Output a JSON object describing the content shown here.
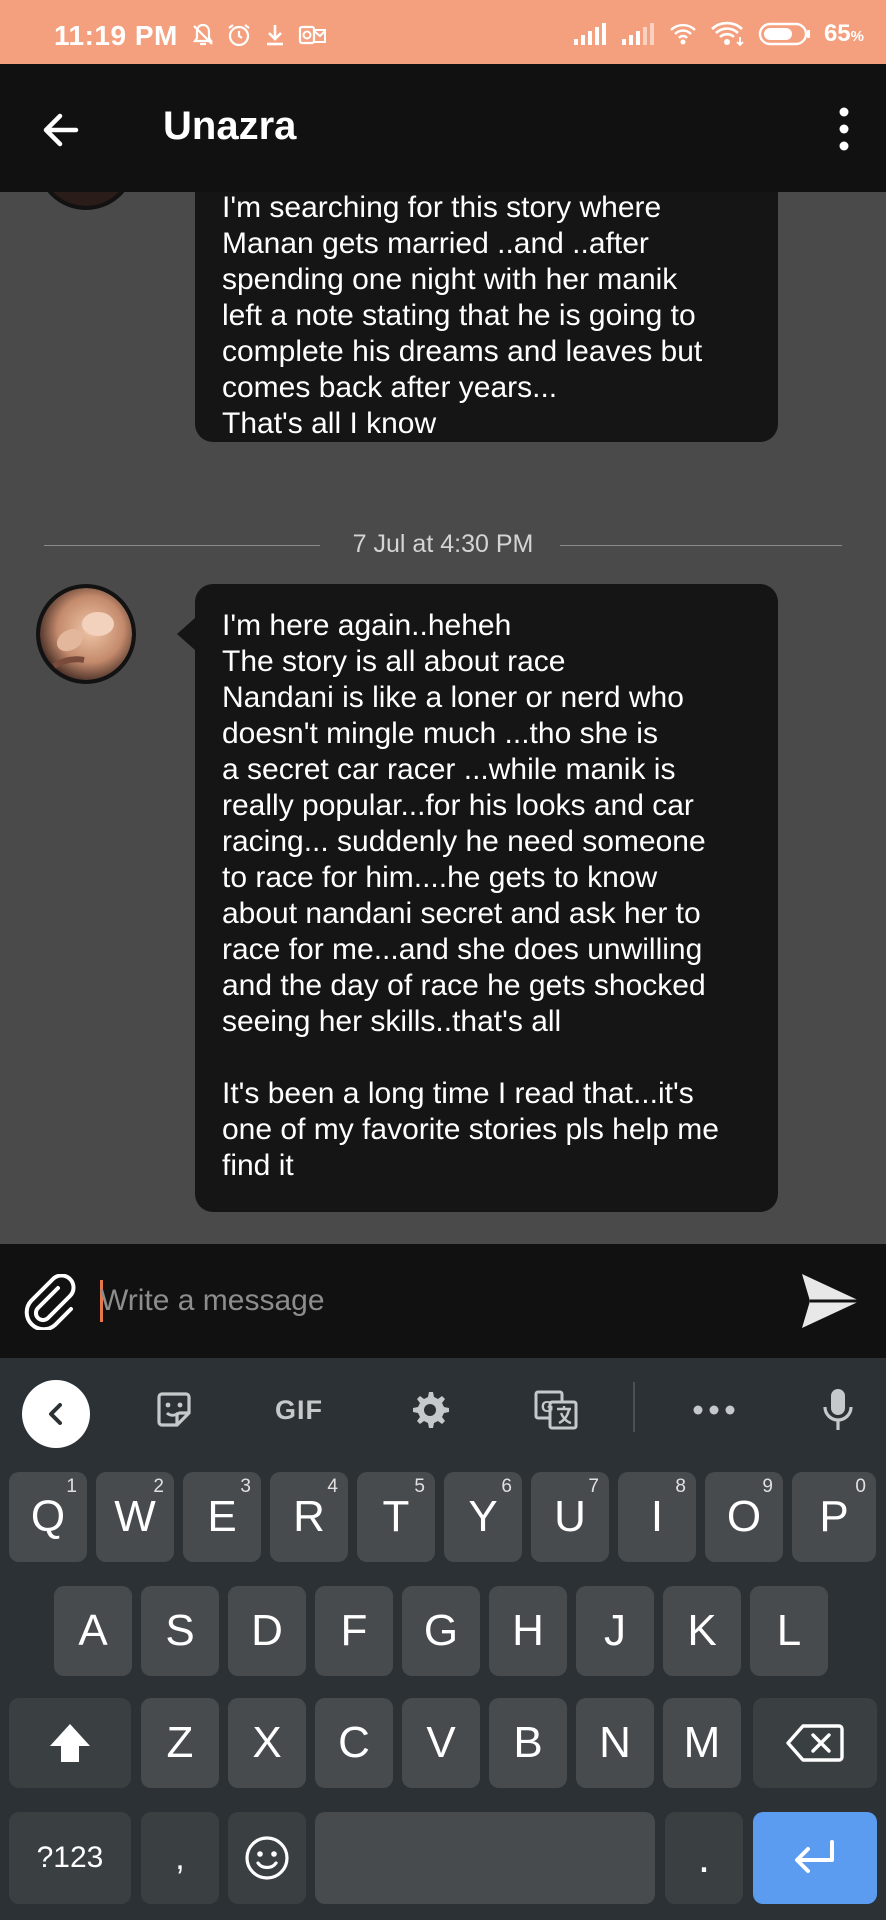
{
  "status_bar": {
    "time": "11:19 PM",
    "battery_percent": "65",
    "battery_unit": "%",
    "left_icons": [
      "mute-bell-icon",
      "alarm-icon",
      "download-icon",
      "outlook-icon"
    ],
    "right_icons": [
      "signal-icon",
      "signal-2-icon",
      "hotspot-icon",
      "wifi-icon",
      "battery-icon"
    ],
    "background": "#f4a07e"
  },
  "app_bar": {
    "title": "Unazra",
    "back_icon": "arrow-left-icon",
    "more_icon": "more-vertical-icon"
  },
  "messages": [
    {
      "text": " I'm searching for this story where\nManan gets married ..and ..after\nspending one night with her manik\nleft a note stating that he is going to\ncomplete his dreams and leaves but\ncomes back after years...\nThat's all I know"
    },
    {
      "text": "I'm here again..heheh\nThe story is all about race\nNandani is like a loner or nerd who\ndoesn't mingle much ...tho she is\na secret car racer ...while manik is\nreally popular...for his looks and car\nracing... suddenly he need someone\nto race for him....he gets to know\nabout nandani secret and ask her to\nrace for me...and she does unwilling\nand the day of race he gets shocked\nseeing her skills..that's all\n\nIt's been a long time I  read that...it's\none of my favorite stories pls help me\nfind it"
    }
  ],
  "date_separator": "7 Jul at 4:30 PM",
  "composer": {
    "placeholder": "Write a message",
    "value": "",
    "attach_icon": "paperclip-icon",
    "send_icon": "send-icon"
  },
  "keyboard": {
    "toolbar": {
      "back_icon": "chevron-left-icon",
      "sticker_icon": "sticker-icon",
      "gif_label": "GIF",
      "settings_icon": "gear-icon",
      "translate_icon": "translate-icon",
      "more_icon": "more-horizontal-icon",
      "mic_icon": "microphone-icon"
    },
    "row1": [
      {
        "label": "Q",
        "hint": "1"
      },
      {
        "label": "W",
        "hint": "2"
      },
      {
        "label": "E",
        "hint": "3"
      },
      {
        "label": "R",
        "hint": "4"
      },
      {
        "label": "T",
        "hint": "5"
      },
      {
        "label": "Y",
        "hint": "6"
      },
      {
        "label": "U",
        "hint": "7"
      },
      {
        "label": "I",
        "hint": "8"
      },
      {
        "label": "O",
        "hint": "9"
      },
      {
        "label": "P",
        "hint": "0"
      }
    ],
    "row2": [
      "A",
      "S",
      "D",
      "F",
      "G",
      "H",
      "J",
      "K",
      "L"
    ],
    "row3": [
      "Z",
      "X",
      "C",
      "V",
      "B",
      "N",
      "M"
    ],
    "bottom": {
      "symbols_label": "?123",
      "comma_label": ",",
      "period_label": ".",
      "emoji_icon": "emoji-icon",
      "shift_icon": "shift-icon",
      "backspace_icon": "backspace-icon",
      "enter_icon": "enter-icon"
    },
    "enter_color": "#5b9bf0"
  }
}
